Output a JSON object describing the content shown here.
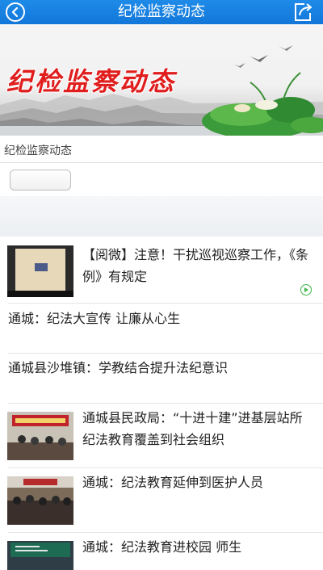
{
  "header": {
    "title": "纪检监察动态"
  },
  "banner": {
    "title": "纪检监察动态"
  },
  "section": {
    "label": "纪检监察动态",
    "tab_label": ""
  },
  "news": [
    {
      "title": "【阅微】注意！干扰巡视巡察工作，《条例》有规定",
      "has_thumb": true,
      "has_video": true
    },
    {
      "title": "通城：纪法大宣传 让廉从心生",
      "has_thumb": false
    },
    {
      "title": "通城县沙堆镇：学教结合提升法纪意识",
      "has_thumb": false
    },
    {
      "title": "通城县民政局：“十进十建”进基层站所 纪法教育覆盖到社会组织",
      "has_thumb": true
    },
    {
      "title": "通城：纪法教育延伸到医护人员",
      "has_thumb": true
    },
    {
      "title": "通城：纪法教育进校园 师生",
      "has_thumb": true
    }
  ],
  "colors": {
    "nav_bar": "#1277d9",
    "banner_title": "#e01e1e",
    "video_badge": "#3fb64a"
  },
  "icons": {
    "back": "back-arrow-icon",
    "share": "share-icon",
    "video": "play-icon"
  }
}
